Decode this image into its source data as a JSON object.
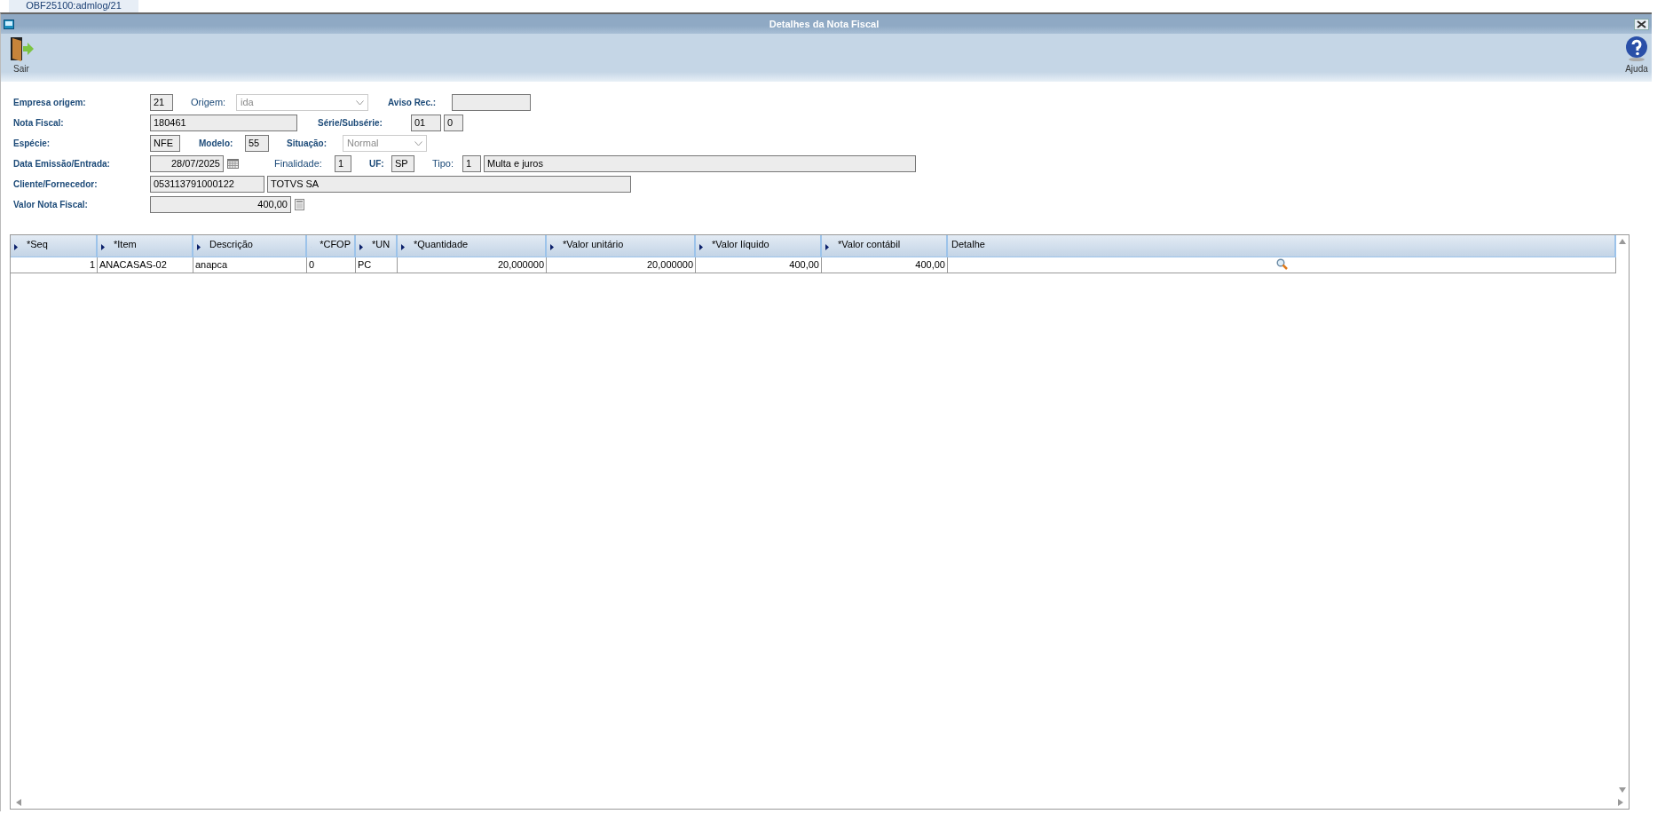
{
  "tab": {
    "label": "OBF25100:admlog/21"
  },
  "window": {
    "title": "Detalhes da Nota Fiscal"
  },
  "toolbar": [
    {
      "label": "Sair",
      "kind": "exit"
    },
    {
      "label": "Ajuda",
      "kind": "help"
    }
  ],
  "form_rows": [
    [
      {
        "kind": "label",
        "text": "Empresa origem:"
      },
      {
        "kind": "input",
        "value": "21"
      },
      {
        "kind": "plain-label",
        "text": "Origem:"
      },
      {
        "kind": "select",
        "value": "ida",
        "disabled": true
      },
      {
        "kind": "label",
        "text": "Aviso Rec.:"
      },
      {
        "kind": "input"
      }
    ],
    [
      {
        "kind": "label",
        "text": "Nota Fiscal:"
      },
      {
        "kind": "input",
        "value": "180461"
      },
      {
        "kind": "label",
        "text": "Série/Subsérie:"
      },
      {
        "kind": "input",
        "value": "01"
      },
      {
        "kind": "input",
        "value": "0"
      }
    ],
    [
      {
        "kind": "label",
        "text": "Espécie:"
      },
      {
        "kind": "input",
        "value": "NFE"
      },
      {
        "kind": "label",
        "text": "Modelo:"
      },
      {
        "kind": "input",
        "value": "55"
      },
      {
        "kind": "label",
        "text": "Situação:"
      },
      {
        "kind": "select",
        "value": "Normal",
        "disabled": true
      }
    ],
    [
      {
        "kind": "label",
        "text": "Data Emissão/Entrada:"
      },
      {
        "kind": "date",
        "value": "28/07/2025"
      },
      {
        "kind": "plain-label",
        "text": "Finalidade:"
      },
      {
        "kind": "input",
        "value": "1"
      },
      {
        "kind": "label",
        "text": "UF:"
      },
      {
        "kind": "input",
        "value": "SP"
      },
      {
        "kind": "plain-label",
        "text": "Tipo:"
      },
      {
        "kind": "input",
        "value": "1"
      },
      {
        "kind": "input",
        "value": "Multa e juros"
      }
    ],
    [
      {
        "kind": "label",
        "text": "Cliente/Fornecedor:"
      },
      {
        "kind": "input",
        "value": "053113791000122"
      },
      {
        "kind": "input",
        "value": "TOTVS SA"
      }
    ],
    [
      {
        "kind": "label",
        "text": "Valor Nota Fiscal:"
      },
      {
        "kind": "amount",
        "value": "400,00"
      }
    ]
  ],
  "table": {
    "columns": [
      {
        "label": "*Seq",
        "arrow": true,
        "kind": "number"
      },
      {
        "label": "*Item",
        "arrow": true,
        "kind": "text"
      },
      {
        "label": "Descrição",
        "arrow": true,
        "kind": "text"
      },
      {
        "label": "*CFOP",
        "arrow": true,
        "kind": "text"
      },
      {
        "label": "*UN",
        "arrow": true,
        "kind": "text"
      },
      {
        "label": "*Quantidade",
        "arrow": true,
        "kind": "number"
      },
      {
        "label": "*Valor unitário",
        "arrow": true,
        "kind": "number"
      },
      {
        "label": "*Valor líquido",
        "arrow": true,
        "kind": "number"
      },
      {
        "label": "*Valor contábil",
        "arrow": true,
        "kind": "number"
      },
      {
        "label": "Detalhe",
        "arrow": false,
        "kind": "detail"
      }
    ],
    "rows": [
      {
        "cells": [
          "1",
          "ANACASAS-02",
          "anapca",
          "0",
          "PC",
          "20,000000",
          "20,000000",
          "400,00",
          "400,00",
          ""
        ]
      }
    ]
  }
}
